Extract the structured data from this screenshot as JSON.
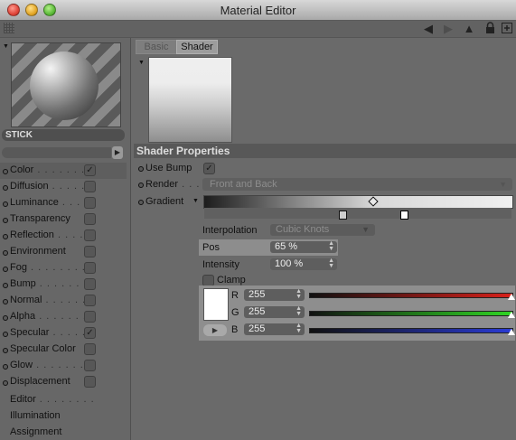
{
  "window": {
    "title": "Material Editor"
  },
  "toolbar": {
    "icons": [
      "grip-icon",
      "back-arrow-icon",
      "forward-arrow-icon",
      "up-arrow-icon",
      "lock-icon",
      "new-window-icon"
    ]
  },
  "material": {
    "name": "STICK"
  },
  "channels": [
    {
      "label": "Color",
      "leader": " . . . . . . .",
      "checked": true
    },
    {
      "label": "Diffusion",
      "leader": " . . . . .",
      "checked": false
    },
    {
      "label": "Luminance",
      "leader": " . . . .",
      "checked": false
    },
    {
      "label": "Transparency",
      "leader": "",
      "checked": false
    },
    {
      "label": "Reflection",
      "leader": " . . . .",
      "checked": false
    },
    {
      "label": "Environment",
      "leader": "",
      "checked": false
    },
    {
      "label": "Fog",
      "leader": " . . . . . . . .",
      "checked": false
    },
    {
      "label": "Bump",
      "leader": " . . . . . . .",
      "checked": false
    },
    {
      "label": "Normal",
      "leader": " . . . . . .",
      "checked": false
    },
    {
      "label": "Alpha",
      "leader": " . . . . . . .",
      "checked": false
    },
    {
      "label": "Specular",
      "leader": " . . . . .",
      "checked": true
    },
    {
      "label": "Specular Color",
      "leader": "",
      "checked": false
    },
    {
      "label": "Glow",
      "leader": " . . . . . . . .",
      "checked": false
    },
    {
      "label": "Displacement",
      "leader": "",
      "checked": false
    }
  ],
  "channels_extra": {
    "editor_label": "Editor",
    "editor_leader": " . . . . . . . .",
    "illumination_label": "Illumination",
    "assignment_label": "Assignment"
  },
  "tabs": {
    "basic": "Basic",
    "shader": "Shader"
  },
  "section": {
    "title": "Shader Properties"
  },
  "use_bump": {
    "label": "Use Bump",
    "checked": true
  },
  "render": {
    "label": "Render",
    "leader": " . . .",
    "value": "Front and Back"
  },
  "gradient": {
    "label": "Gradient",
    "knots": [
      0.45,
      0.65
    ],
    "selected_knot": 1,
    "interp_marker": 0.55
  },
  "interpolation": {
    "label": "Interpolation",
    "value": "Cubic Knots"
  },
  "pos": {
    "label": "Pos",
    "value": "65 %"
  },
  "intensity": {
    "label": "Intensity",
    "value": "100 %"
  },
  "clamp": {
    "label": "Clamp",
    "checked": false
  },
  "color": {
    "swatch": "#ffffff",
    "r": {
      "label": "R",
      "value": "255",
      "level": 1.0
    },
    "g": {
      "label": "G",
      "value": "255",
      "level": 1.0
    },
    "b": {
      "label": "B",
      "value": "255",
      "level": 1.0
    }
  }
}
